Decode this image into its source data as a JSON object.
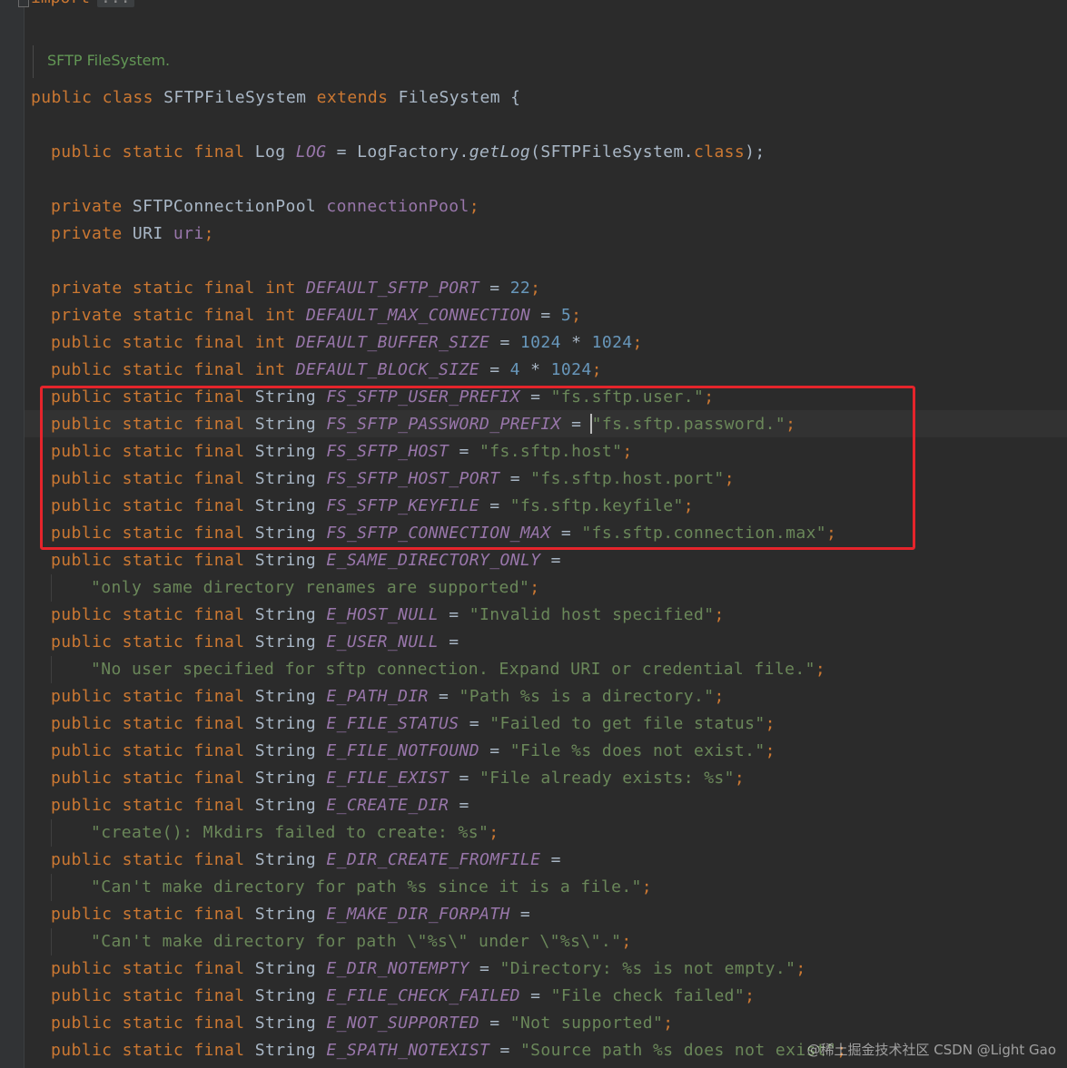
{
  "editor": {
    "import_keyword": "import",
    "import_collapsed": "...",
    "doc_comment": "SFTP FileSystem.",
    "watermark": "@稀土掘金技术社区 CSDN @Light Gao"
  },
  "code": {
    "class_decl": {
      "mods": "public class ",
      "name": "SFTPFileSystem",
      "ext": " extends ",
      "base": "FileSystem",
      "brace": " {"
    },
    "log_line": {
      "mods": "public static final ",
      "type": "Log ",
      "name": "LOG",
      "eq": " = LogFactory.",
      "method": "getLog",
      "arg": "(SFTPFileSystem.",
      "cls_kw": "class",
      "end": ");"
    },
    "pool_line": {
      "mods": "private ",
      "type": "SFTPConnectionPool ",
      "name": "connectionPool",
      "end": ";"
    },
    "uri_line": {
      "mods": "private ",
      "type": "URI ",
      "name": "uri",
      "end": ";"
    },
    "int_constants": [
      {
        "mods": "private static final int ",
        "name": "DEFAULT_SFTP_PORT",
        "eq": " = ",
        "v1": "22",
        "op": "",
        "v2": "",
        "end": ";"
      },
      {
        "mods": "private static final int ",
        "name": "DEFAULT_MAX_CONNECTION",
        "eq": " = ",
        "v1": "5",
        "op": "",
        "v2": "",
        "end": ";"
      },
      {
        "mods": "public static final int ",
        "name": "DEFAULT_BUFFER_SIZE",
        "eq": " = ",
        "v1": "1024",
        "op": " * ",
        "v2": "1024",
        "end": ";"
      },
      {
        "mods": "public static final int ",
        "name": "DEFAULT_BLOCK_SIZE",
        "eq": " = ",
        "v1": "4",
        "op": " * ",
        "v2": "1024",
        "end": ";"
      }
    ],
    "string_constants": [
      {
        "name": "FS_SFTP_USER_PREFIX",
        "value": "\"fs.sftp.user.\"",
        "wrap": false
      },
      {
        "name": "FS_SFTP_PASSWORD_PREFIX",
        "value": "\"fs.sftp.password.\"",
        "wrap": false
      },
      {
        "name": "FS_SFTP_HOST",
        "value": "\"fs.sftp.host\"",
        "wrap": false
      },
      {
        "name": "FS_SFTP_HOST_PORT",
        "value": "\"fs.sftp.host.port\"",
        "wrap": false
      },
      {
        "name": "FS_SFTP_KEYFILE",
        "value": "\"fs.sftp.keyfile\"",
        "wrap": false
      },
      {
        "name": "FS_SFTP_CONNECTION_MAX",
        "value": "\"fs.sftp.connection.max\"",
        "wrap": false
      },
      {
        "name": "E_SAME_DIRECTORY_ONLY",
        "value": "\"only same directory renames are supported\"",
        "wrap": true
      },
      {
        "name": "E_HOST_NULL",
        "value": "\"Invalid host specified\"",
        "wrap": false
      },
      {
        "name": "E_USER_NULL",
        "value": "\"No user specified for sftp connection. Expand URI or credential file.\"",
        "wrap": true
      },
      {
        "name": "E_PATH_DIR",
        "value": "\"Path %s is a directory.\"",
        "wrap": false
      },
      {
        "name": "E_FILE_STATUS",
        "value": "\"Failed to get file status\"",
        "wrap": false
      },
      {
        "name": "E_FILE_NOTFOUND",
        "value": "\"File %s does not exist.\"",
        "wrap": false
      },
      {
        "name": "E_FILE_EXIST",
        "value": "\"File already exists: %s\"",
        "wrap": false
      },
      {
        "name": "E_CREATE_DIR",
        "value": "\"create(): Mkdirs failed to create: %s\"",
        "wrap": true
      },
      {
        "name": "E_DIR_CREATE_FROMFILE",
        "value": "\"Can't make directory for path %s since it is a file.\"",
        "wrap": true
      },
      {
        "name": "E_MAKE_DIR_FORPATH",
        "value": "\"Can't make directory for path \\\"%s\\\" under \\\"%s\\\".\"",
        "wrap": true
      },
      {
        "name": "E_DIR_NOTEMPTY",
        "value": "\"Directory: %s is not empty.\"",
        "wrap": false
      },
      {
        "name": "E_FILE_CHECK_FAILED",
        "value": "\"File check failed\"",
        "wrap": false
      },
      {
        "name": "E_NOT_SUPPORTED",
        "value": "\"Not supported\"",
        "wrap": false
      },
      {
        "name": "E_SPATH_NOTEXIST",
        "value": "\"Source path %s does not exist\"",
        "wrap": false
      }
    ],
    "string_mods": {
      "pub": "public static final ",
      "type": "String ",
      "eq": " = ",
      "end": ";"
    }
  },
  "colors": {
    "background": "#2b2b2b",
    "keyword": "#cc7832",
    "field": "#9876aa",
    "string": "#6a8759",
    "number": "#6897bb",
    "comment": "#629755",
    "highlight_box": "#e5242b"
  }
}
